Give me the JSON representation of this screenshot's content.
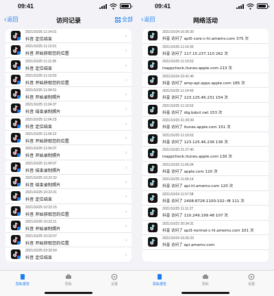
{
  "status_time": "09:41",
  "left": {
    "nav": {
      "back": "返回",
      "title": "访问记录",
      "all": "全部"
    },
    "rows": [
      {
        "ts": "2021/10/25 11:14:01",
        "text": "抖音 定位结束"
      },
      {
        "ts": "2021/10/25 11:13:51",
        "text": "抖音 开始获取您的位置"
      },
      {
        "ts": "2021/10/25 11:11:05",
        "text": "抖音 定位结束"
      },
      {
        "ts": "2021/10/25 11:10:53",
        "text": "抖音 开始获取您的位置"
      },
      {
        "ts": "2021/10/25 11:04:51",
        "text": "抖音 开始录制照片"
      },
      {
        "ts": "2021/10/25 11:04:37",
        "text": "抖音 结束录制照片"
      },
      {
        "ts": "2021/10/25 11:04:23",
        "text": "抖音 定位结束"
      },
      {
        "ts": "2021/10/25 11:04:12",
        "text": "抖音 开始获取您的位置"
      },
      {
        "ts": "2021/10/25 11:04:07",
        "text": "抖音 开始录制照片"
      },
      {
        "ts": "2021/10/25 11:04:07",
        "text": "抖音 结束录制照片"
      },
      {
        "ts": "2021/10/25 10:22:32",
        "text": "抖音 结束录制照片"
      },
      {
        "ts": "2021/10/25 10:22:21",
        "text": "抖音 定位结束"
      },
      {
        "ts": "2021/10/25 10:22:15",
        "text": "抖音 开始获取您的位置"
      },
      {
        "ts": "2021/10/25 10:22:11",
        "text": "抖音 开始录制照片"
      },
      {
        "ts": "2021/10/25 10:22:07",
        "text": "抖音 开始获取您的位置"
      },
      {
        "ts": "2021/10/25 02:32:54",
        "text": "抖音 定位结束"
      }
    ]
  },
  "right": {
    "nav": {
      "back": "返回",
      "title": "网络活动"
    },
    "rows": [
      {
        "ts": "2021/10/24 16:35:30",
        "text": "抖音 访问了 api5-core-c-hl.amemv.com 375 次"
      },
      {
        "ts": "2021/10/25 11:14:30",
        "text": "抖音 访问了 117.15.237.110 262 次"
      },
      {
        "ts": "2021/10/25 11:10:53",
        "text": "inappcheck.itunes.apple.com 213 次"
      },
      {
        "ts": "2021/10/24 16:41:45",
        "text": "抖音 访问了 amp-api.apps.apple.com 185 次"
      },
      {
        "ts": "2021/10/25 11:14:43",
        "text": "抖音 访问了 123.125.46.231 154 次"
      },
      {
        "ts": "2021/10/25 11:10:53",
        "text": "抖音 访问了 dig.bdurl.net 153 次"
      },
      {
        "ts": "2021/10/20 21:29:39",
        "text": "抖音 访问了 itunes.apple.com 151 次"
      },
      {
        "ts": "2021/10/25 11:10:53",
        "text": "抖音 访问了 123.125.46.236 136 次"
      },
      {
        "ts": "2021/10/20 21:27:40",
        "text": "inappcheck.itunes.apple.com 130 次"
      },
      {
        "ts": "2021/10/25 11:05:04",
        "text": "抖音 访问了 apple.com 120 次"
      },
      {
        "ts": "2021/10/25 11:04:14",
        "text": "抖音 访问了 api-hl.amemv.com 120 次"
      },
      {
        "ts": "2021/10/24 11:57:58",
        "text": "抖音 访问了 2408:8726:1100:102::f8 111 次"
      },
      {
        "ts": "2021/10/25 11:11:27",
        "text": "抖音 访问了 110.249.199.48 107 次"
      },
      {
        "ts": "2021/10/22 20:34:31",
        "text": "抖音 访问了 api3-normal-c-hl.amemv.com 101 次"
      },
      {
        "ts": "2021/10/24 16:26:23",
        "text": "抖音 访问了 api.amemv.com"
      }
    ]
  },
  "tabs": [
    {
      "label": "隐私报告",
      "icon": "report-icon"
    },
    {
      "label": "隐私",
      "icon": "privacy-icon"
    },
    {
      "label": "设置",
      "icon": "settings-icon"
    }
  ],
  "colors": {
    "accent": "#1b7ef0",
    "bg": "#f2f2f7"
  }
}
